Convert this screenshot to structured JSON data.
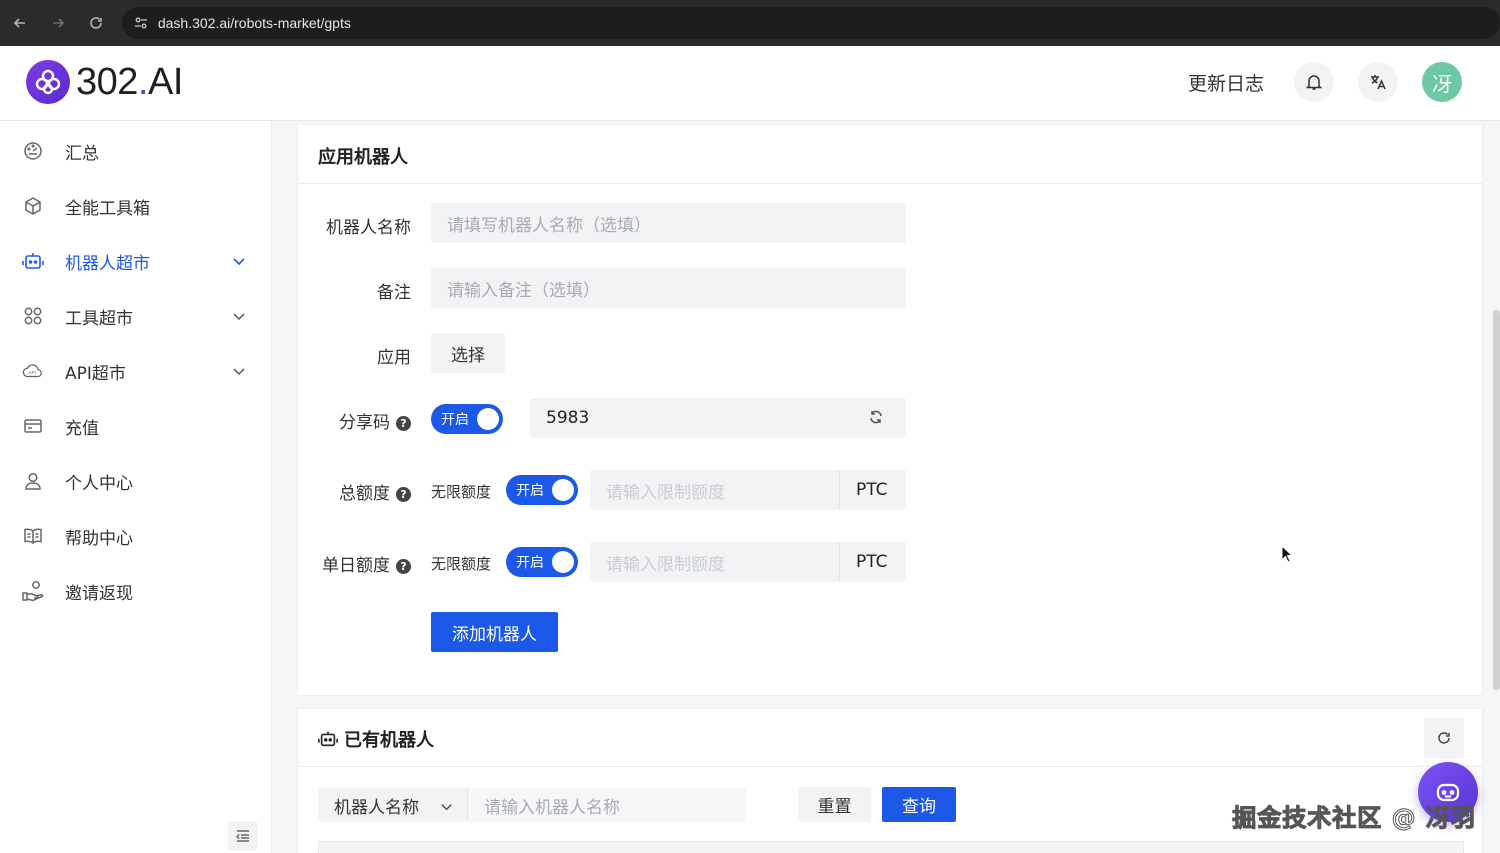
{
  "browser": {
    "url": "dash.302.ai/robots-market/gpts"
  },
  "header": {
    "logo_text": "302",
    "logo_dot": ".",
    "logo_suffix": "AI",
    "changelog": "更新日志",
    "avatar_text": "冴"
  },
  "sidebar": {
    "items": [
      {
        "label": "汇总",
        "icon": "dashboard-icon"
      },
      {
        "label": "全能工具箱",
        "icon": "cube-icon"
      },
      {
        "label": "机器人超市",
        "icon": "robot-icon",
        "active": true
      },
      {
        "label": "工具超市",
        "icon": "grid-icon"
      },
      {
        "label": "API超市",
        "icon": "cloud-api-icon"
      },
      {
        "label": "充值",
        "icon": "card-icon"
      },
      {
        "label": "个人中心",
        "icon": "user-icon"
      },
      {
        "label": "帮助中心",
        "icon": "book-icon"
      },
      {
        "label": "邀请返现",
        "icon": "hand-coin-icon"
      }
    ]
  },
  "app_robot": {
    "title": "应用机器人",
    "name_label": "机器人名称",
    "name_placeholder": "请填写机器人名称（选填）",
    "note_label": "备注",
    "note_placeholder": "请输入备注（选填）",
    "app_label": "应用",
    "select_btn": "选择",
    "share_label": "分享码",
    "share_toggle": "开启",
    "share_code": "5983",
    "total_label": "总额度",
    "unlimited_label": "无限额度",
    "total_toggle": "开启",
    "limit_placeholder": "请输入限制额度",
    "unit": "PTC",
    "daily_label": "单日额度",
    "daily_toggle": "开启",
    "add_btn": "添加机器人"
  },
  "existing": {
    "title": "已有机器人",
    "filter_select": "机器人名称",
    "filter_placeholder": "请输入机器人名称",
    "reset_btn": "重置",
    "query_btn": "查询"
  },
  "watermark": "掘金技术社区 @ 冴羽",
  "colors": {
    "accent": "#1d59e8",
    "brand": "#6c3ae0",
    "avatar": "#6cc9a1"
  }
}
